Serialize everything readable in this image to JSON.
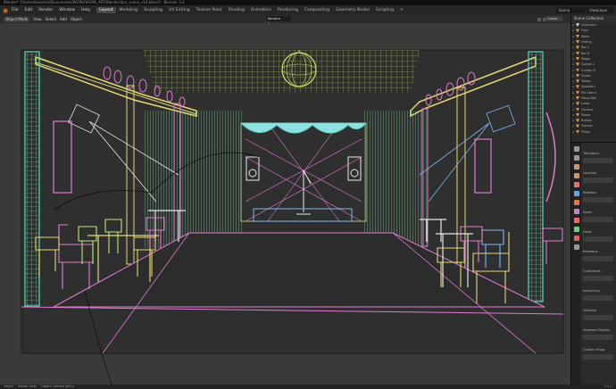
{
  "window_title": "Blender* [/home/bluedark/Documents/WORK/WORK_ART/Blender/bar_scene_v14.blend] - Blender 3.4",
  "menu": {
    "file": "File",
    "edit": "Edit",
    "render": "Render",
    "window": "Window",
    "help": "Help"
  },
  "workspaces": [
    "Layout",
    "Modeling",
    "Sculpting",
    "UV Editing",
    "Texture Paint",
    "Shading",
    "Animation",
    "Rendering",
    "Compositing",
    "Geometry Nodes",
    "Scripting"
  ],
  "add_workspace": "+",
  "scene": "Scene",
  "view_layer": "ViewLayer",
  "viewport": {
    "mode": "Object Mode",
    "view": "View",
    "select": "Select",
    "add": "Add",
    "object": "Object",
    "camera": "Kamera Basics",
    "shading": "Global"
  },
  "outliner": {
    "title": "Scene Collection",
    "rows": [
      "Collection",
      "Floor",
      "Walls",
      "Ceiling",
      "Bar L",
      "Bar R",
      "Stage",
      "Curtain L",
      "Curtain R",
      "Chairs",
      "Tables",
      "Speakers",
      "Mic Stand",
      "Disco Ball",
      "Lamp",
      "Camera",
      "Plants",
      "Bottles",
      "Frames",
      "Pillars"
    ]
  },
  "properties": {
    "rows": [
      "Transform",
      "Location",
      "Rotation",
      "Scale",
      "Delta",
      "Relations",
      "Collections",
      "Instancing",
      "Visibility",
      "Viewport Display",
      "Custom Props"
    ]
  },
  "status": {
    "select": "Select",
    "rotate": "Rotate View",
    "menu": "Object Context Menu",
    "version": "3.4.1"
  },
  "colors": {
    "wire_pink": "#e07ad0",
    "wire_green": "#78e0a0",
    "wire_yellow": "#e8d870",
    "wire_cyan": "#5ad6c8",
    "wire_lime": "#b8ea78",
    "wire_blue": "#80b8f0",
    "accent_orange": "#e87d0d"
  }
}
